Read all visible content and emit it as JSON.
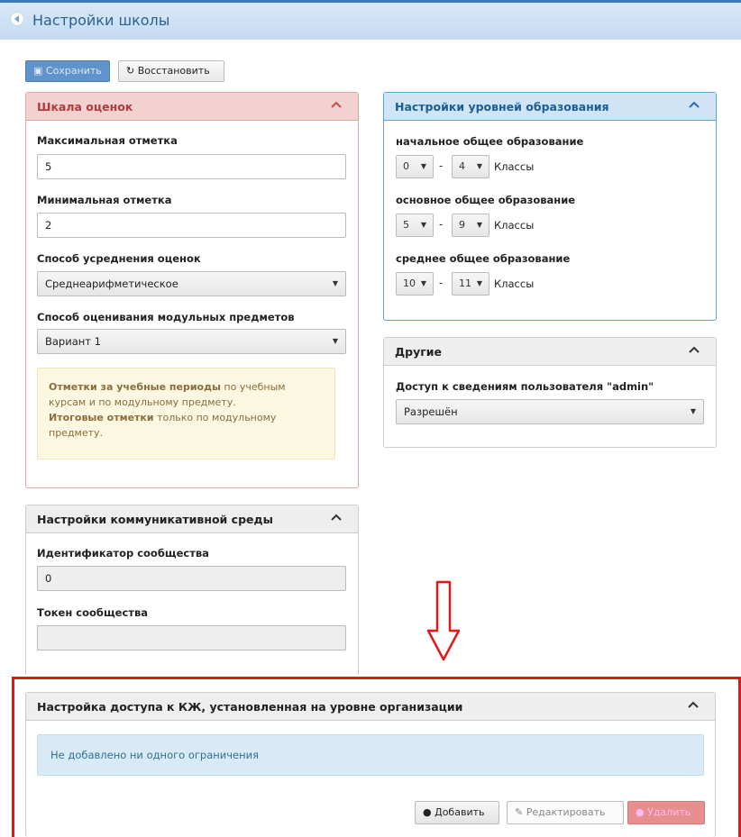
{
  "header": {
    "title": "Настройки школы"
  },
  "toolbar": {
    "save_label": "Сохранить",
    "restore_label": "Восстановить"
  },
  "grades": {
    "title": "Шкала оценок",
    "max_label": "Максимальная отметка",
    "max_value": "5",
    "min_label": "Минимальная отметка",
    "min_value": "2",
    "avg_label": "Способ усреднения оценок",
    "avg_value": "Среднеарифметическое",
    "modular_label": "Способ оценивания модульных предметов",
    "modular_value": "Вариант 1",
    "note": {
      "part1_bold": "Отметки за учебные периоды",
      "part1_rest": " по учебным курсам и по модульному предмету.",
      "part2_bold": "Итоговые отметки",
      "part2_rest": " только по модульному предмету."
    }
  },
  "levels": {
    "title": "Настройки уровней образования",
    "classes_word": "Классы",
    "items": [
      {
        "label": "начальное общее образование",
        "from": "0",
        "to": "4"
      },
      {
        "label": "основное общее образование",
        "from": "5",
        "to": "9"
      },
      {
        "label": "среднее общее образование",
        "from": "10",
        "to": "11"
      }
    ]
  },
  "other": {
    "title": "Другие",
    "access_label": "Доступ к сведениям пользователя \"admin\"",
    "access_value": "Разрешён"
  },
  "comm": {
    "title": "Настройки коммуникативной среды",
    "id_label": "Идентификатор сообщества",
    "id_value": "0",
    "token_label": "Токен сообщества",
    "token_value": ""
  },
  "access": {
    "title": "Настройка доступа к КЖ, установленная на уровне организации",
    "empty_text": "Не добавлено ни одного ограничения",
    "add_label": "Добавить",
    "edit_label": "Редактировать",
    "delete_label": "Удалить"
  },
  "colors": {
    "header_blue": "#2d5f91",
    "panel_red": "#b23a3a",
    "panel_blue": "#1c5d94",
    "highlight_frame": "#e01818"
  }
}
